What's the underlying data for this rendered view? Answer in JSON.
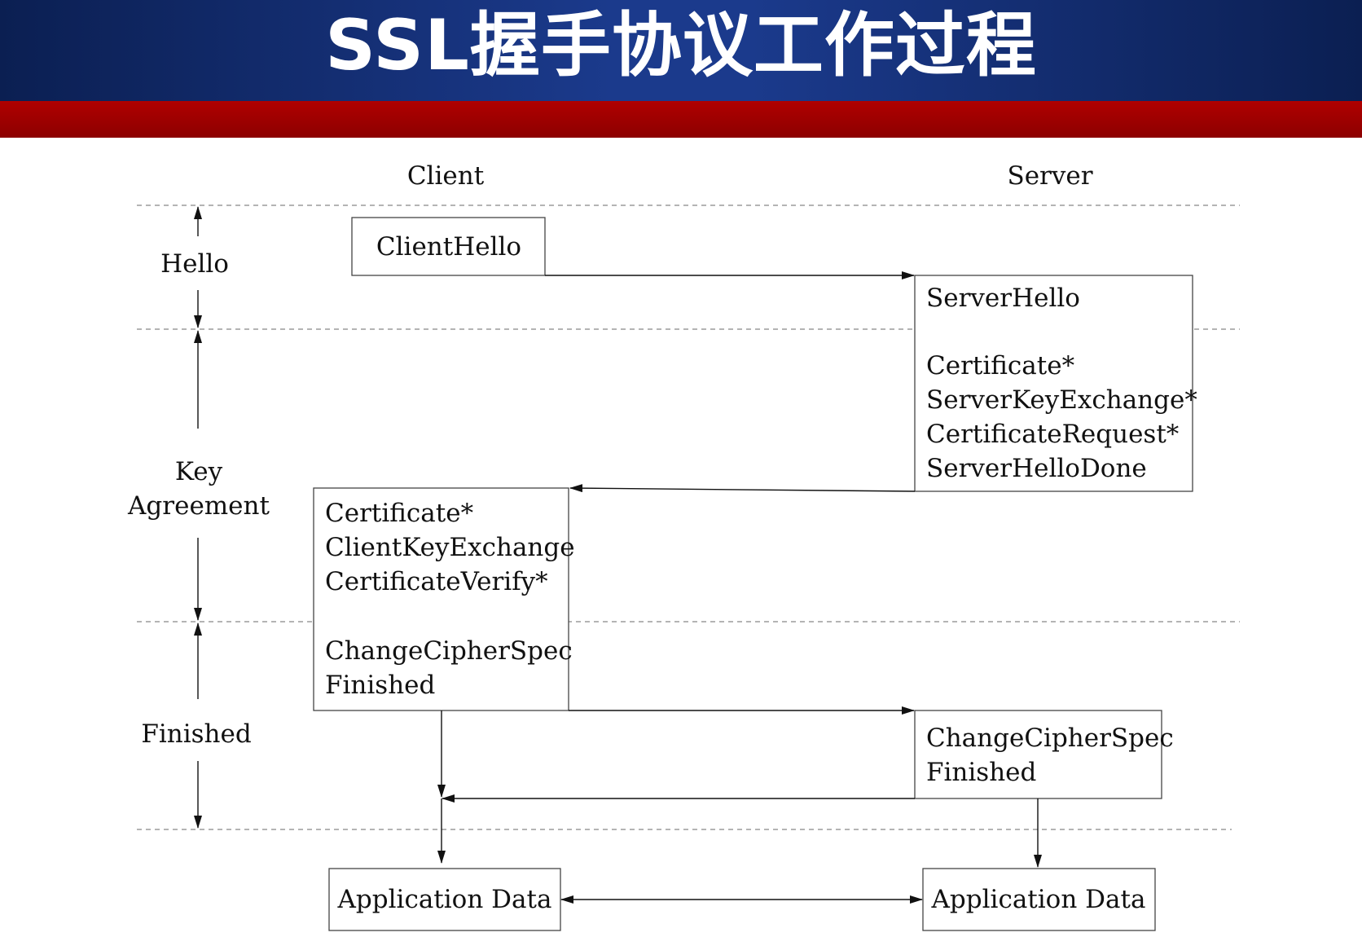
{
  "title": "SSL握手协议工作过程",
  "headers": {
    "client": "Client",
    "server": "Server"
  },
  "phases": {
    "hello": "Hello",
    "key_line1": "Key",
    "key_line2": "Agreement",
    "finished": "Finished"
  },
  "client_hello": "ClientHello",
  "server_hello": "ServerHello",
  "server_key_messages": [
    "Certificate*",
    "ServerKeyExchange*",
    "CertificateRequest*",
    "ServerHelloDone"
  ],
  "client_key_messages": [
    "Certificate*",
    "ClientKeyExchange",
    "CertificateVerify*"
  ],
  "client_finish_messages": [
    "ChangeCipherSpec",
    "Finished"
  ],
  "server_finish_messages": [
    "ChangeCipherSpec",
    "Finished"
  ],
  "app_data": {
    "client": "Application Data",
    "server": "Application Data"
  },
  "colors": {
    "title_bg": "#1b3a8c",
    "accent_bar": "#9a0000",
    "title_text": "#ffffff"
  }
}
